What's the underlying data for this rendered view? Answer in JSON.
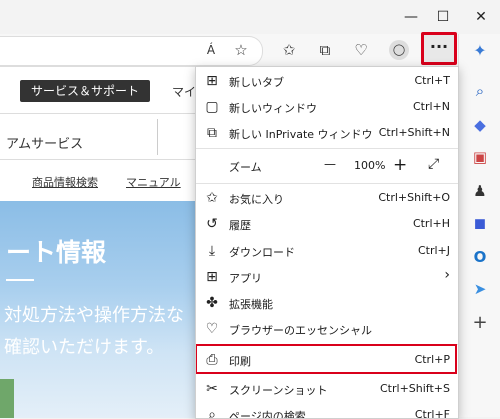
{
  "window": {
    "minimize_icon": "minimize-icon",
    "maximize_icon": "maximize-icon",
    "close_icon": "close-icon",
    "minimize_glyph": "—",
    "maximize_glyph": "☐",
    "close_glyph": "✕"
  },
  "toolbar": {
    "read_aloud_glyph": "Á",
    "menu_glyph": "···",
    "highlight_color": "#d9001b"
  },
  "webpage": {
    "support_button": "サービス＆サポート",
    "right_label": "マイ",
    "service_label": "アムサービス",
    "link1": "商品情報検索",
    "link2": "マニュアル",
    "hero_title": "ート情報",
    "hero_text1": "対処方法や操作方法な",
    "hero_text2": "確認いただけます。"
  },
  "menu": {
    "new_tab": {
      "label": "新しいタブ",
      "shortcut": "Ctrl+T"
    },
    "new_window": {
      "label": "新しいウィンドウ",
      "shortcut": "Ctrl+N"
    },
    "new_inprivate": {
      "label": "新しい InPrivate ウィンドウ",
      "shortcut": "Ctrl+Shift+N"
    },
    "zoom": {
      "label": "ズーム",
      "minus": "—",
      "value": "100%",
      "plus": "+"
    },
    "favorites": {
      "label": "お気に入り",
      "shortcut": "Ctrl+Shift+O"
    },
    "history": {
      "label": "履歴",
      "shortcut": "Ctrl+H"
    },
    "downloads": {
      "label": "ダウンロード",
      "shortcut": "Ctrl+J"
    },
    "apps": {
      "label": "アプリ",
      "arrow": "›"
    },
    "extensions": {
      "label": "拡張機能"
    },
    "essentials": {
      "label": "ブラウザーのエッセンシャル"
    },
    "print": {
      "label": "印刷",
      "shortcut": "Ctrl+P"
    },
    "screenshot": {
      "label": "スクリーンショット",
      "shortcut": "Ctrl+Shift+S"
    },
    "find": {
      "label": "ページ内の検索",
      "shortcut": "Ctrl+F"
    }
  },
  "sidebar": {
    "add_glyph": "+"
  }
}
